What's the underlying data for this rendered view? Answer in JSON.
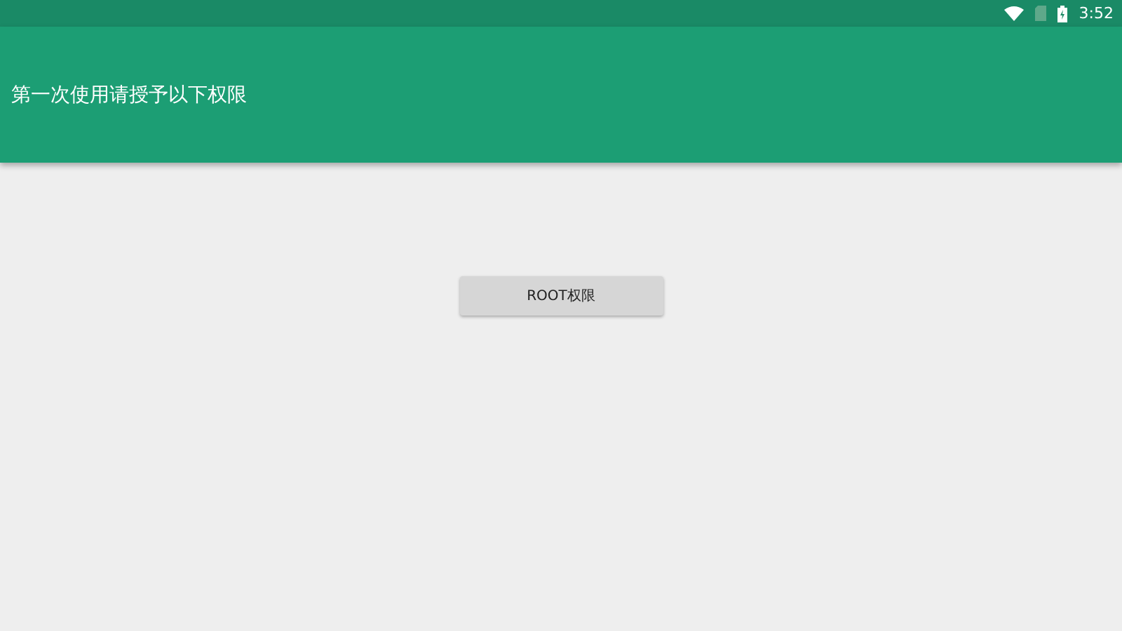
{
  "status_bar": {
    "time": "3:52"
  },
  "app_bar": {
    "title": "第一次使用请授予以下权限"
  },
  "buttons": [
    {
      "label": "ROOT权限"
    }
  ]
}
